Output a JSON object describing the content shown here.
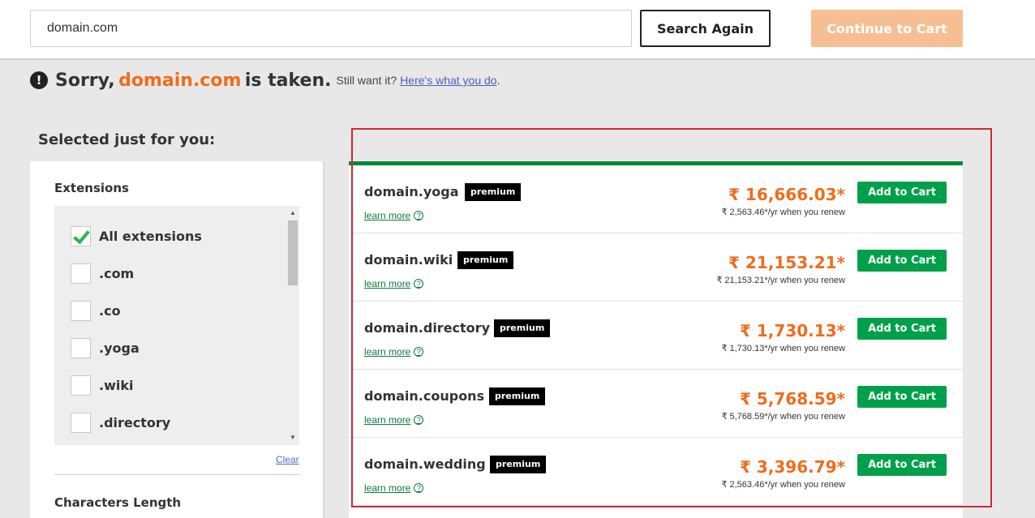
{
  "search": {
    "value": "domain.com",
    "again_label": "Search Again",
    "continue_label": "Continue to Cart"
  },
  "taken": {
    "prefix": "Sorry,",
    "domain": "domain.com",
    "suffix": "is taken.",
    "still": "Still want it?",
    "link": "Here's what you do",
    "dot": "."
  },
  "sidebar": {
    "title": "Selected just for you:",
    "extensions_title": "Extensions",
    "extensions": [
      {
        "label": "All extensions",
        "checked": true
      },
      {
        "label": ".com",
        "checked": false
      },
      {
        "label": ".co",
        "checked": false
      },
      {
        "label": ".yoga",
        "checked": false
      },
      {
        "label": ".wiki",
        "checked": false
      },
      {
        "label": ".directory",
        "checked": false
      }
    ],
    "clear_label": "Clear",
    "chars_title": "Characters Length",
    "scroll_up": "▲",
    "scroll_down": "▼"
  },
  "results": [
    {
      "domain": "domain.yoga",
      "badge": "premium",
      "learn": "learn more",
      "price": "₹ 16,666.03*",
      "renew": "₹ 2,563.46*/yr when you renew",
      "button": "Add to Cart"
    },
    {
      "domain": "domain.wiki",
      "badge": "premium",
      "learn": "learn more",
      "price": "₹ 21,153.21*",
      "renew": "₹ 21,153.21*/yr when you renew",
      "button": "Add to Cart"
    },
    {
      "domain": "domain.directory",
      "badge": "premium",
      "learn": "learn more",
      "price": "₹ 1,730.13*",
      "renew": "₹ 1,730.13*/yr when you renew",
      "button": "Add to Cart"
    },
    {
      "domain": "domain.coupons",
      "badge": "premium",
      "learn": "learn more",
      "price": "₹ 5,768.59*",
      "renew": "₹ 5,768.59*/yr when you renew",
      "button": "Add to Cart"
    },
    {
      "domain": "domain.wedding",
      "badge": "premium",
      "learn": "learn more",
      "price": "₹ 3,396.79*",
      "renew": "₹ 2,563.46*/yr when you renew",
      "button": "Add to Cart"
    }
  ],
  "icons": {
    "alert": "!",
    "help": "?"
  },
  "colors": {
    "accent_orange": "#ef6c1c",
    "cart_green": "#00a04a",
    "results_border": "#008a35",
    "highlight_red": "#d0282f"
  }
}
